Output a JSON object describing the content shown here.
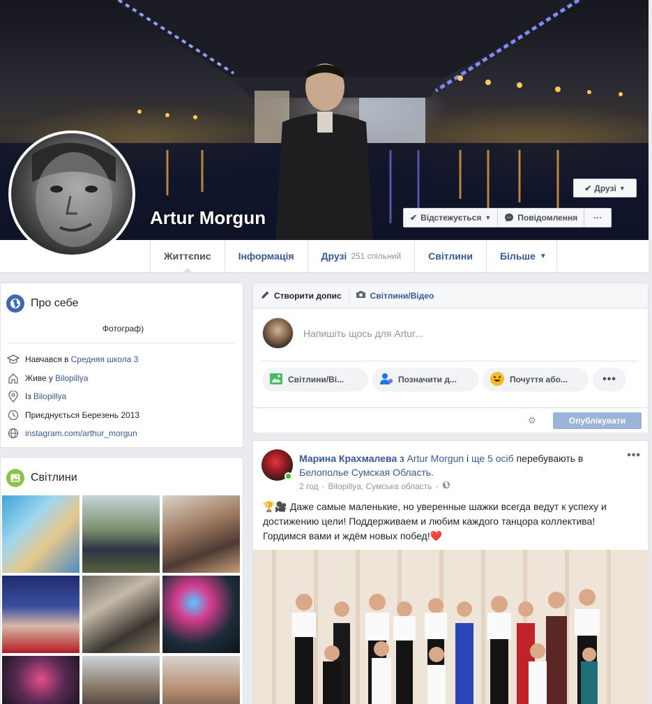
{
  "profile": {
    "name": "Artur Morgun",
    "friends_button": "Друзі",
    "following_button": "Відстежується",
    "message_button": "Повідомлення",
    "more_button": "···"
  },
  "nav": {
    "tabs": [
      {
        "label": "Життєпис"
      },
      {
        "label": "Інформація"
      },
      {
        "label": "Друзі",
        "count": "251 спільний"
      },
      {
        "label": "Світлини"
      },
      {
        "label": "Більше"
      }
    ]
  },
  "about": {
    "title": "Про себе",
    "intro": "Фотограф)",
    "items": [
      {
        "icon": "education-icon",
        "prefix": "Навчався в ",
        "link": "Средняя школа 3"
      },
      {
        "icon": "home-icon",
        "prefix": "Живе у ",
        "link": "Bilopillya"
      },
      {
        "icon": "location-pin-icon",
        "prefix": "Із ",
        "link": "Bilopillya"
      },
      {
        "icon": "clock-icon",
        "prefix": "Приєднується Березень 2013",
        "link": ""
      },
      {
        "icon": "globe-icon",
        "prefix": "",
        "link": "instagram.com/arthur_morgun"
      }
    ]
  },
  "photos": {
    "title": "Світлини"
  },
  "composer": {
    "tab_create": "Створити допис",
    "tab_photo": "Світлини/Відео",
    "placeholder": "Напишіть щось для Artur...",
    "pill_photo": "Світлини/Ві...",
    "pill_tag": "Позначити д...",
    "pill_feeling": "Почуття або...",
    "publish": "Опублікувати"
  },
  "post": {
    "author": "Марина Крахмалева",
    "with_text": " з ",
    "tagged": "Artur Morgun",
    "and_text": " і ",
    "others": "ще 5 осіб",
    "at_text": " перебувають в ",
    "place": "Белополье Сумская Область.",
    "time": "2 год",
    "location": "Bilopillya, Сумська область",
    "separator": "·",
    "text": "🏆🎥 Даже самые маленькие, но уверенные шажки всегда ведут к успеху и достижению цели! Поддерживаем и любим каждого танцора коллектива! Гордимся вами и ждём новых побед!❤️"
  },
  "colors": {
    "link": "#365899",
    "publish_disabled": "#9cb4d8",
    "online": "#42b72a"
  }
}
